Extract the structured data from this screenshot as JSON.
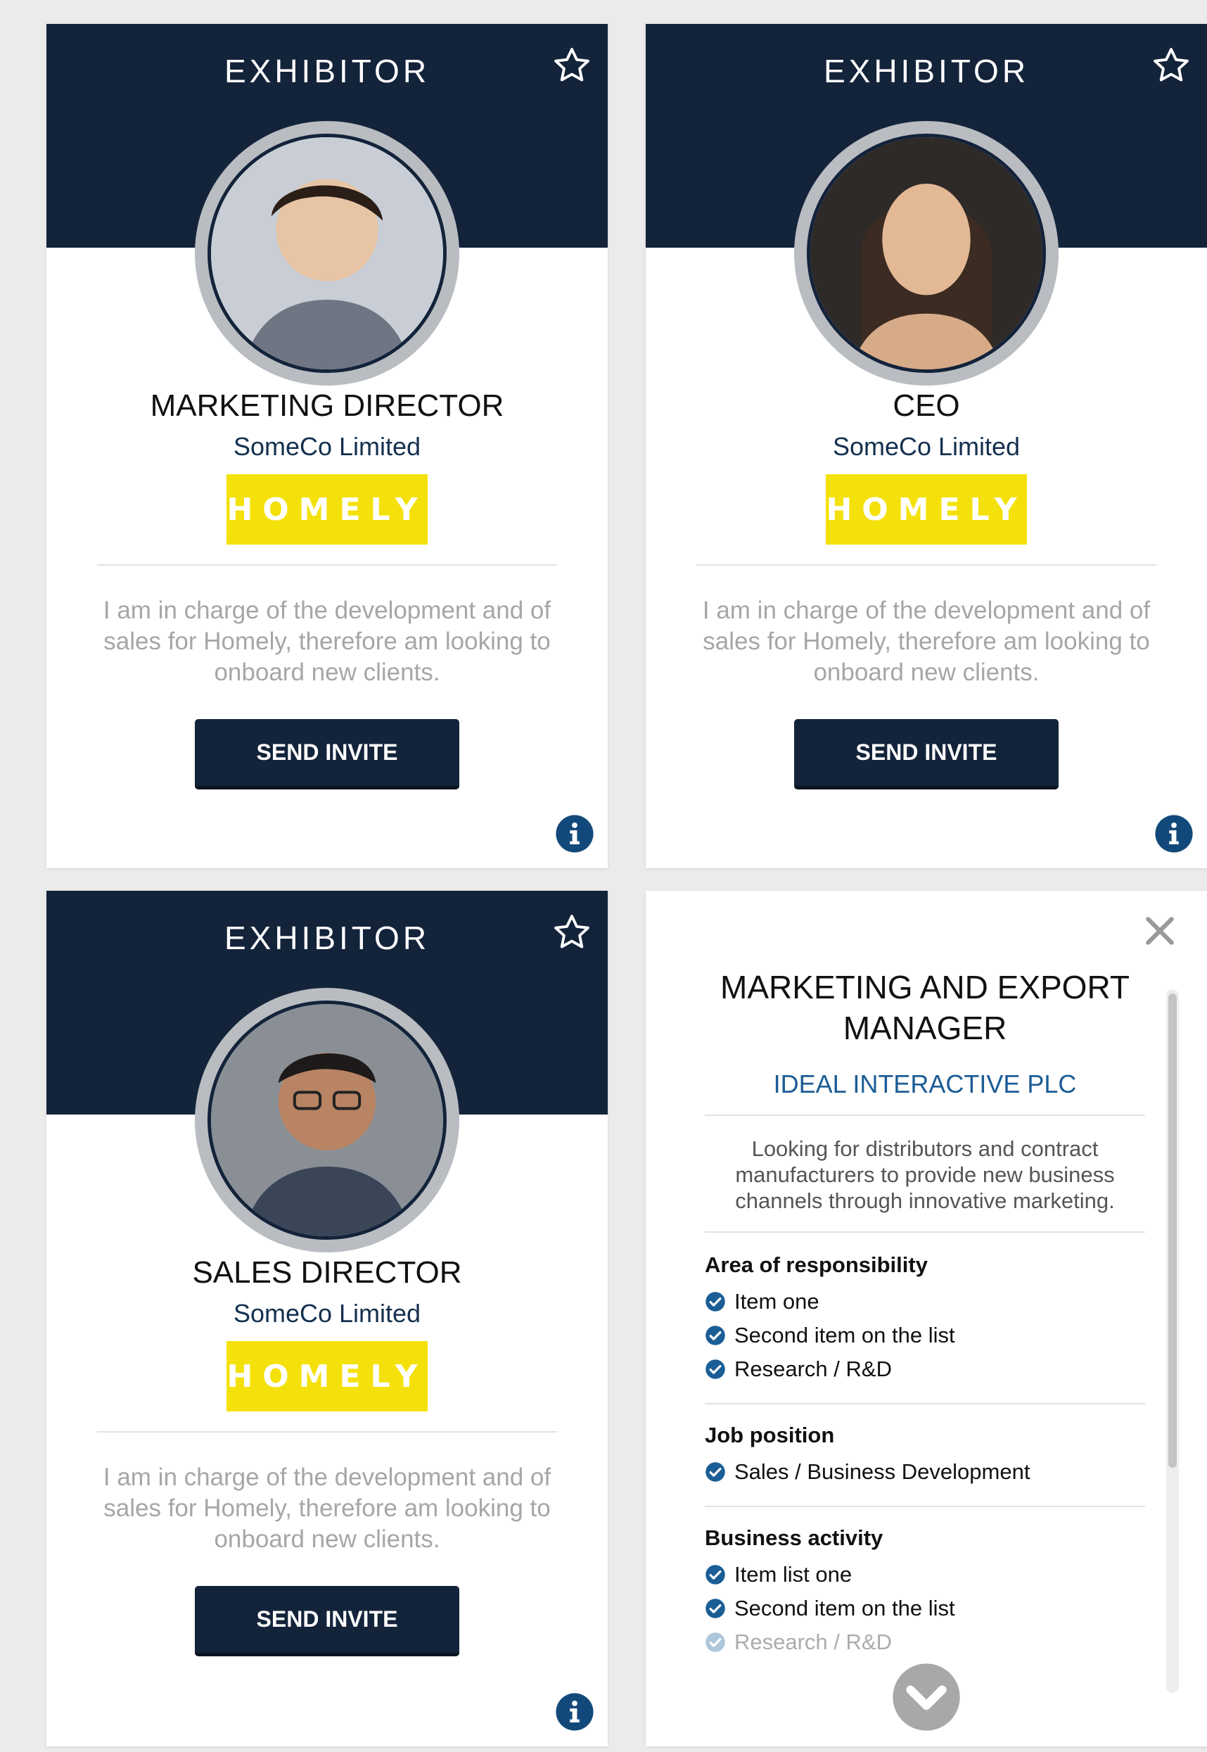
{
  "colors": {
    "header": "#13233a",
    "accent_blue": "#1c5c96",
    "logo_yellow": "#f4e10b",
    "bio_grey": "#a6a6a6"
  },
  "cards": [
    {
      "label": "EXHIBITOR",
      "role": "MARKETING DIRECTOR",
      "company": "SomeCo Limited",
      "logo_text": "HOMELY",
      "bio": "I am in charge of the development and of sales for Homely, therefore am looking to onboard new clients.",
      "button": "SEND INVITE",
      "icons": [
        "star-icon",
        "info-icon"
      ]
    },
    {
      "label": "EXHIBITOR",
      "role": "CEO",
      "company": "SomeCo Limited",
      "logo_text": "HOMELY",
      "bio": "I am in charge of the development and of sales for Homely, therefore am looking to onboard new clients.",
      "button": "SEND INVITE",
      "icons": [
        "star-icon",
        "info-icon"
      ]
    },
    {
      "label": "EXHIBITOR",
      "role": "SALES DIRECTOR",
      "company": "SomeCo Limited",
      "logo_text": "HOMELY",
      "bio": "I am in charge of the development and of sales for Homely, therefore am looking to onboard new clients.",
      "button": "SEND INVITE",
      "icons": [
        "star-icon",
        "info-icon"
      ]
    }
  ],
  "detail": {
    "title": "MARKETING AND EXPORT MANAGER",
    "company": "IDEAL INTERACTIVE PLC",
    "summary": "Looking for distributors and contract manufacturers to provide new business channels through innovative marketing.",
    "sections": [
      {
        "heading": "Area of responsibility",
        "items": [
          "Item one",
          "Second item on the list",
          "Research / R&D"
        ]
      },
      {
        "heading": "Job position",
        "items": [
          "Sales / Business Development"
        ]
      },
      {
        "heading": "Business activity",
        "items": [
          "Item list one",
          "Second item on the list",
          "Research / R&D"
        ]
      }
    ],
    "icons": [
      "close-icon",
      "check-icon",
      "chevron-down-icon"
    ]
  }
}
